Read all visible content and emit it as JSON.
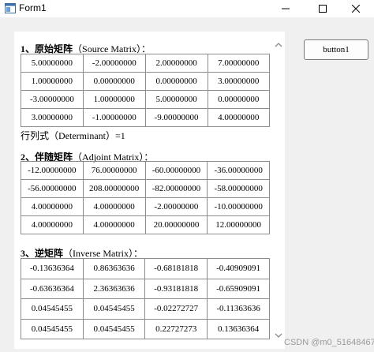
{
  "window": {
    "title": "Form1"
  },
  "button1": {
    "label": "button1"
  },
  "source": {
    "title_num": "1、",
    "title_cn": "原始矩阵",
    "title_en": "（Source Matrix）：",
    "rows": [
      [
        "5.00000000",
        "-2.00000000",
        "2.00000000",
        "7.00000000"
      ],
      [
        "1.00000000",
        "0.00000000",
        "0.00000000",
        "3.00000000"
      ],
      [
        "-3.00000000",
        "1.00000000",
        "5.00000000",
        "0.00000000"
      ],
      [
        "3.00000000",
        "-1.00000000",
        "-9.00000000",
        "4.00000000"
      ]
    ]
  },
  "determinant": {
    "label": "行列式（Determinant）=1"
  },
  "adjoint": {
    "title_num": "2、",
    "title_cn": "伴随矩阵",
    "title_en": "（Adjoint Matrix）：",
    "rows": [
      [
        "-12.00000000",
        "76.00000000",
        "-60.00000000",
        "-36.00000000"
      ],
      [
        "-56.00000000",
        "208.00000000",
        "-82.00000000",
        "-58.00000000"
      ],
      [
        "4.00000000",
        "4.00000000",
        "-2.00000000",
        "-10.00000000"
      ],
      [
        "4.00000000",
        "4.00000000",
        "20.00000000",
        "12.00000000"
      ]
    ]
  },
  "inverse": {
    "title_num": "3、",
    "title_cn": "逆矩阵",
    "title_en": "（Inverse Matrix）：",
    "rows": [
      [
        "-0.13636364",
        "0.86363636",
        "-0.68181818",
        "-0.40909091"
      ],
      [
        "-0.63636364",
        "2.36363636",
        "-0.93181818",
        "-0.65909091"
      ],
      [
        "0.04545455",
        "0.04545455",
        "-0.02272727",
        "-0.11363636"
      ],
      [
        "0.04545455",
        "0.04545455",
        "0.22727273",
        "0.13636364"
      ]
    ]
  },
  "watermark": "CSDN @m0_51648467"
}
